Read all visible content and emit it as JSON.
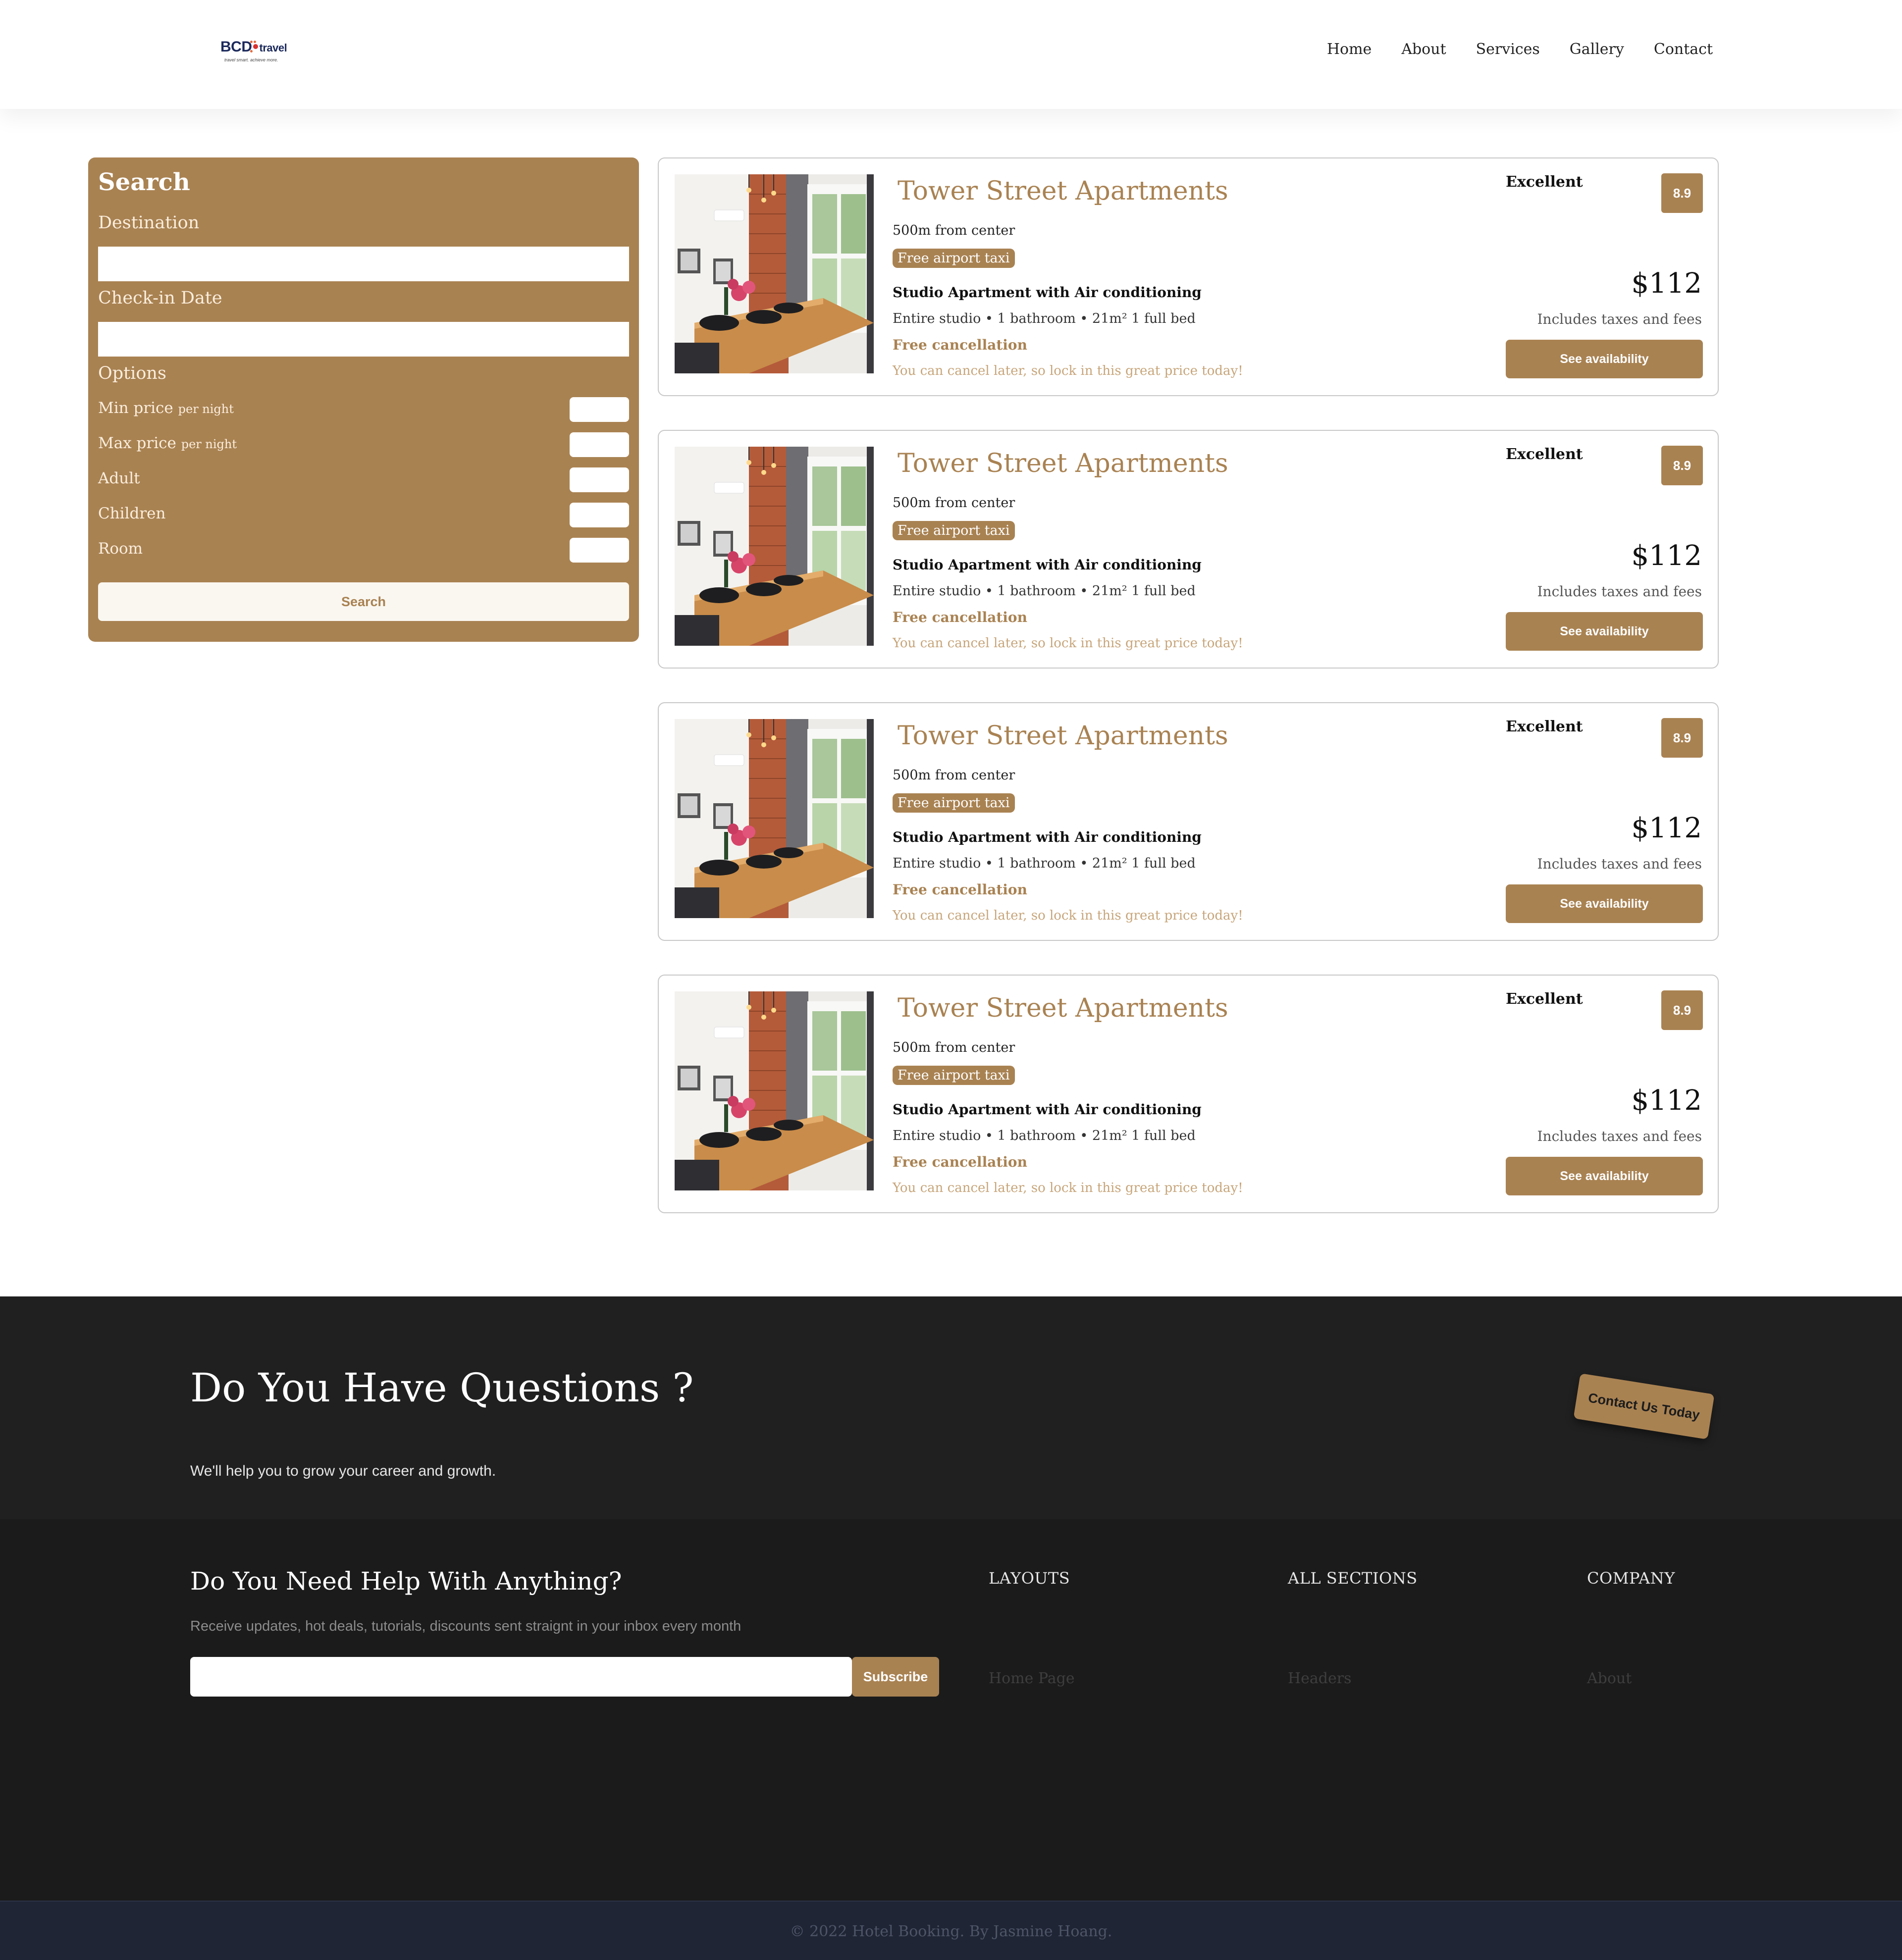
{
  "header": {
    "logo_main": "BCD",
    "logo_travel": "travel",
    "logo_tagline": "travel smart. achieve more.",
    "nav": [
      "Home",
      "About",
      "Services",
      "Gallery",
      "Contact"
    ]
  },
  "search": {
    "title": "Search",
    "destination_label": "Destination",
    "destination_value": "",
    "checkin_label": "Check-in Date",
    "checkin_value": "",
    "options_label": "Options",
    "options": [
      {
        "label": "Min price",
        "suffix": "per night",
        "value": ""
      },
      {
        "label": "Max price",
        "suffix": "per night",
        "value": ""
      },
      {
        "label": "Adult",
        "suffix": "",
        "value": ""
      },
      {
        "label": "Children",
        "suffix": "",
        "value": ""
      },
      {
        "label": "Room",
        "suffix": "",
        "value": ""
      }
    ],
    "button": "Search"
  },
  "results": [
    {
      "title": "Tower Street Apartments",
      "distance": "500m from center",
      "taxi": "Free airport taxi",
      "subtitle": "Studio Apartment with Air conditioning",
      "features": "Entire studio • 1 bathroom • 21m² 1 full bed",
      "cancel": "Free cancellation",
      "cancel_sub": "You can cancel later, so lock in this great price today!",
      "rating_text": "Excellent",
      "rating": "8.9",
      "price": "$112",
      "taxes": "Includes taxes and fees",
      "button": "See availability"
    },
    {
      "title": "Tower Street Apartments",
      "distance": "500m from center",
      "taxi": "Free airport taxi",
      "subtitle": "Studio Apartment with Air conditioning",
      "features": "Entire studio • 1 bathroom • 21m² 1 full bed",
      "cancel": "Free cancellation",
      "cancel_sub": "You can cancel later, so lock in this great price today!",
      "rating_text": "Excellent",
      "rating": "8.9",
      "price": "$112",
      "taxes": "Includes taxes and fees",
      "button": "See availability"
    },
    {
      "title": "Tower Street Apartments",
      "distance": "500m from center",
      "taxi": "Free airport taxi",
      "subtitle": "Studio Apartment with Air conditioning",
      "features": "Entire studio • 1 bathroom • 21m² 1 full bed",
      "cancel": "Free cancellation",
      "cancel_sub": "You can cancel later, so lock in this great price today!",
      "rating_text": "Excellent",
      "rating": "8.9",
      "price": "$112",
      "taxes": "Includes taxes and fees",
      "button": "See availability"
    },
    {
      "title": "Tower Street Apartments",
      "distance": "500m from center",
      "taxi": "Free airport taxi",
      "subtitle": "Studio Apartment with Air conditioning",
      "features": "Entire studio • 1 bathroom • 21m² 1 full bed",
      "cancel": "Free cancellation",
      "cancel_sub": "You can cancel later, so lock in this great price today!",
      "rating_text": "Excellent",
      "rating": "8.9",
      "price": "$112",
      "taxes": "Includes taxes and fees",
      "button": "See availability"
    }
  ],
  "questions": {
    "title": "Do You Have Questions ?",
    "subtitle": "We'll help you to grow your career and growth.",
    "button": "Contact Us Today"
  },
  "footer": {
    "title": "Do You Need Help With Anything?",
    "description": "Receive updates, hot deals, tutorials, discounts sent straignt in your inbox every month",
    "email_value": "",
    "subscribe": "Subscribe",
    "columns": [
      {
        "title": "LAYOUTS",
        "link": "Home Page"
      },
      {
        "title": "ALL SECTIONS",
        "link": "Headers"
      },
      {
        "title": "COMPANY",
        "link": "About"
      }
    ],
    "copyright": "© 2022 Hotel Booking. By Jasmine Hoang."
  },
  "colors": {
    "accent": "#a98252",
    "dark_band": "#202020",
    "footer_bg": "#1b1b1b",
    "bottom_bar": "#1f2535"
  }
}
